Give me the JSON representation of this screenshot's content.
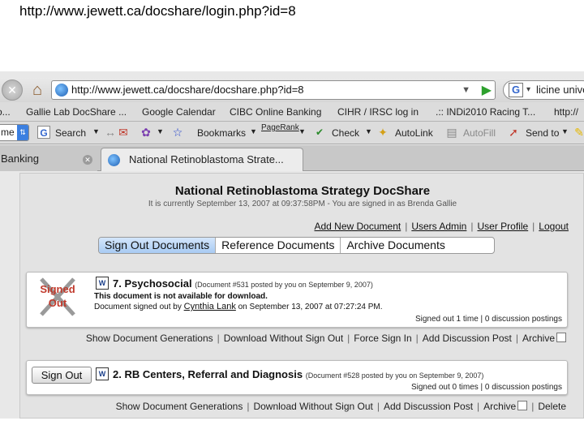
{
  "caption_url": "http://www.jewett.ca/docshare/login.php?id=8",
  "browser": {
    "url": "http://www.jewett.ca/docshare/docshare.php?id=8",
    "search_text": "licine unive",
    "bookmarks": [
      "o...",
      "Gallie Lab DocShare ...",
      "Google Calendar",
      "CIBC Online Banking",
      "CIHR / IRSC log in",
      ".:: INDi2010 Racing T...",
      "http://"
    ],
    "toolbar": {
      "name_select": "me",
      "search": "Search",
      "bookmarks": "Bookmarks",
      "pagerank": "PageRank",
      "check": "Check",
      "autolink": "AutoLink",
      "autofill": "AutoFill",
      "sendto": "Send to"
    },
    "tabs": {
      "inactive": "Banking",
      "active": "National Retinoblastoma Strate..."
    }
  },
  "page": {
    "title": "National Retinoblastoma Strategy DocShare",
    "subtitle": "It is currently September 13, 2007 at 09:37:58PM - You are signed in as Brenda Gallie",
    "admin_links": [
      "Add New Document",
      "Users Admin",
      "User Profile",
      "Logout"
    ],
    "doc_tabs": [
      "Sign Out Documents",
      "Reference Documents",
      "Archive Documents"
    ]
  },
  "documents": [
    {
      "stamp_line1": "Signed",
      "stamp_line2": "Out",
      "title": "7. Psychosocial",
      "meta": "(Document #531 posted by you on September 9, 2007)",
      "line1": "This document is not available for download.",
      "line2_prefix": "Document signed out by",
      "line2_user": "Cynthia Lank",
      "line2_suffix": "on September 13, 2007 at 07:27:24 PM.",
      "stats": "Signed out 1 time | 0 discussion postings",
      "actions": [
        "Show Document Generations",
        "Download Without Sign Out",
        "Force Sign In",
        "Add Discussion Post",
        "Archive"
      ]
    },
    {
      "button": "Sign Out",
      "title": "2. RB Centers, Referral and Diagnosis",
      "meta": "(Document #528 posted by you on September 9, 2007)",
      "stats": "Signed out 0 times | 0 discussion postings",
      "actions": [
        "Show Document Generations",
        "Download Without Sign Out",
        "Add Discussion Post",
        "Archive",
        "Delete"
      ]
    }
  ]
}
